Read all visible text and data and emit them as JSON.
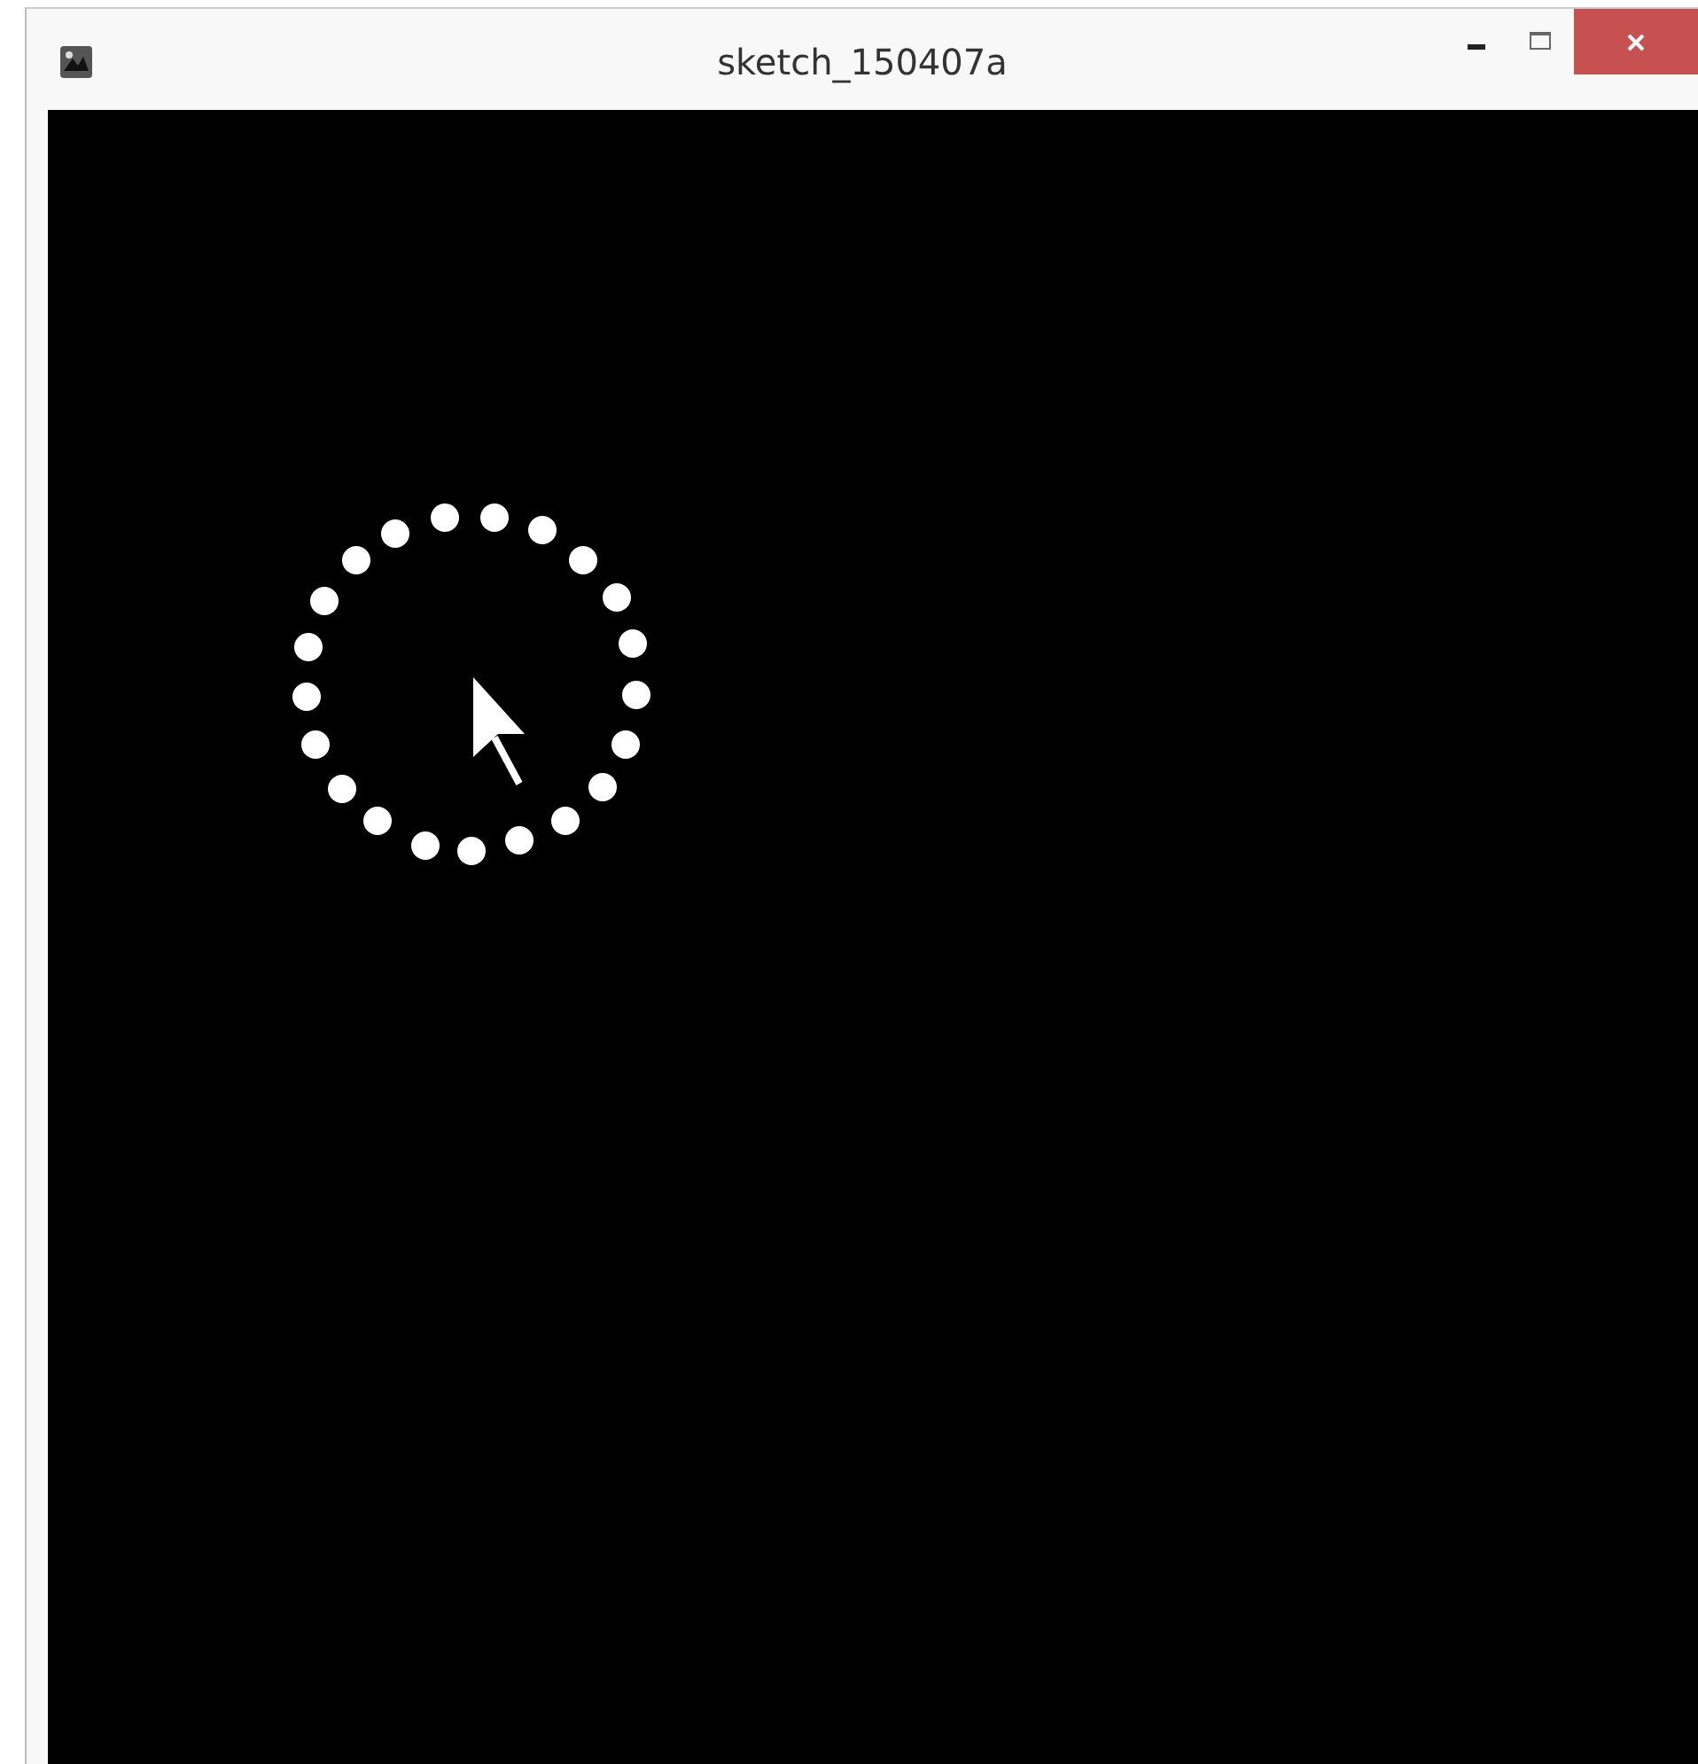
{
  "window": {
    "title": "sketch_150407a"
  }
}
